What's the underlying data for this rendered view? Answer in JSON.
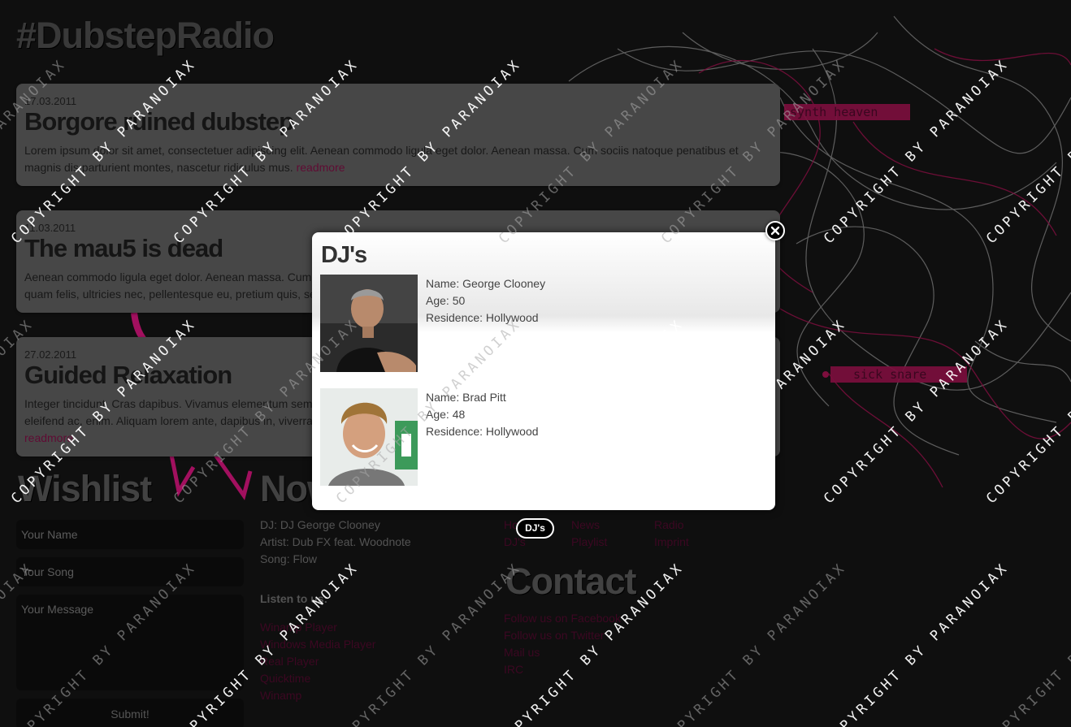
{
  "site": {
    "title": "#DubstepRadio"
  },
  "news": [
    {
      "date": "17.03.2011",
      "title": "Borgore ruined dubstep",
      "body": "Lorem ipsum dolor sit amet, consectetuer adipiscing elit. Aenean commodo ligula eget dolor. Aenean massa. Cum sociis natoque penatibus et magnis dis parturient montes, nascetur ridiculus mus.",
      "readmore": "readmore"
    },
    {
      "date": "11.03.2011",
      "title": "The mau5 is dead",
      "body": "Aenean commodo ligula eget dolor. Aenean massa. Cum sociis natoque penatibus et magnis dis parturient montes, nascetur ridiculus mus. Donec quam felis, ultricies nec, pellentesque eu, pretium quis, sem.",
      "readmore": ""
    },
    {
      "date": "27.02.2011",
      "title": "Guided Relaxation",
      "body": "Integer tincidunt. Cras dapibus. Vivamus elementum semper nisi. Aenean vulputate eleifend tellus. Aenean leo ligula, porttitor eu, consequat vitae, eleifend ac, enim. Aliquam lorem ante, dapibus in, viverra quis, feugiat a, tellus. Phasellus viverra nulla ut metus varius laoreet. Aenean imperdiet.",
      "readmore": "readmore"
    }
  ],
  "bg_labels": {
    "label1": "synth heaven",
    "label2": "sick snare"
  },
  "wishlist": {
    "title": "Wishlist",
    "name_placeholder": "Your Name",
    "song_placeholder": "Your Song",
    "message_placeholder": "Your Message",
    "submit_label": "Submit!"
  },
  "now_playing": {
    "title": "Now",
    "dj": "DJ: DJ George Clooney",
    "artist": "Artist: Dub FX feat. Woodnote",
    "song": "Song: Flow",
    "listen_label": "Listen to us:",
    "players": [
      "Winamp Player",
      "Windows Media Player",
      "Real Player",
      "Quicktime",
      "Winamp"
    ]
  },
  "nav": {
    "badge": "DJ's",
    "items": [
      "Home",
      "News",
      "Radio",
      "DJ's",
      "Playlist",
      "Imprint"
    ]
  },
  "contact": {
    "title": "Contact",
    "links": [
      "Follow us on Facebook",
      "Follow us on Twitter",
      "Mail us",
      "IRC"
    ]
  },
  "modal": {
    "title": "DJ's",
    "djs": [
      {
        "name": "Name: George Clooney",
        "age": "Age: 50",
        "residence": "Residence: Hollywood"
      },
      {
        "name": "Name: Brad Pitt",
        "age": "Age: 48",
        "residence": "Residence: Hollywood"
      }
    ]
  },
  "watermark_text": "COPYRIGHT BY PARANOIAX",
  "colors": {
    "accent_pink": "#d0157a",
    "card_gray": "#5c5c5c",
    "background": "#141414"
  }
}
